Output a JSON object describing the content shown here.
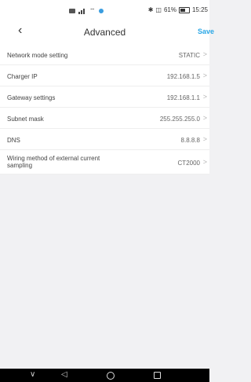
{
  "status_bar": {
    "battery": "61%",
    "time": "15:25"
  },
  "header": {
    "back_icon": "‹",
    "title": "Advanced",
    "save_label": "Save"
  },
  "rows": [
    {
      "label": "Network mode setting",
      "value": "STATIC"
    },
    {
      "label": "Charger IP",
      "value": "192.168.1.5"
    },
    {
      "label": "Gateway settings",
      "value": "192.168.1.1"
    },
    {
      "label": "Subnet mask",
      "value": "255.255.255.0"
    },
    {
      "label": "DNS",
      "value": "8.8.8.8"
    },
    {
      "label": "Wiring method of external current sampling",
      "value": "CT2000"
    }
  ],
  "nav": {
    "down_icon": "∨",
    "back_icon": "◁"
  },
  "colors": {
    "accent": "#2aa7e6",
    "background": "#f1f1f3"
  }
}
